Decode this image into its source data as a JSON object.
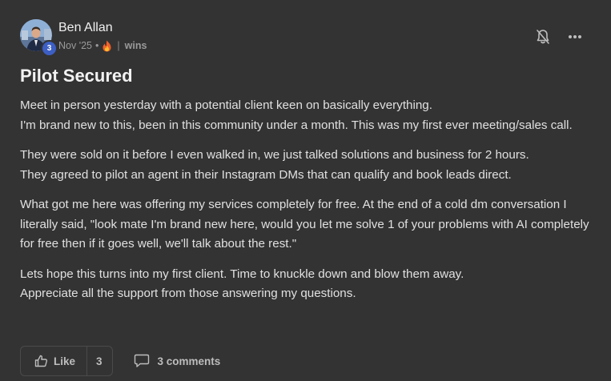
{
  "post": {
    "author": {
      "name": "Ben Allan",
      "level": "3"
    },
    "date": "Nov '25",
    "dot": "•",
    "pipe": "|",
    "category": "wins",
    "title": "Pilot Secured",
    "paragraphs": [
      [
        "Meet in person yesterday with a potential client keen on basically everything.",
        "I'm brand new to this, been in this community under a month. This was my first ever meeting/sales call."
      ],
      [
        "They were sold on it before I even walked in, we just talked solutions and business for 2 hours.",
        "They agreed to pilot an agent in their Instagram DMs that can qualify and book leads direct."
      ],
      [
        "What got me here was offering my services completely for free. At the end of a cold dm conversation I literally said, \"look mate I'm brand new here, would you let me solve 1 of your problems with AI completely for free then if it goes well, we'll talk about the rest.\""
      ],
      [
        "Lets hope this turns into my first client. Time to knuckle down and blow them away.",
        "Appreciate all the support from those answering my questions."
      ]
    ],
    "footer": {
      "like_label": "Like",
      "like_count": "3",
      "comments_label": "3 comments"
    }
  },
  "icons": {
    "fire": "fire-icon",
    "bell": "bell-off-icon",
    "more": "more-horizontal-icon",
    "like": "thumbs-up-icon",
    "comment": "comment-icon"
  },
  "colors": {
    "background": "#333333",
    "badge": "#3d5fc4",
    "text": "#e0e0e0",
    "muted": "#9a9a9a"
  }
}
